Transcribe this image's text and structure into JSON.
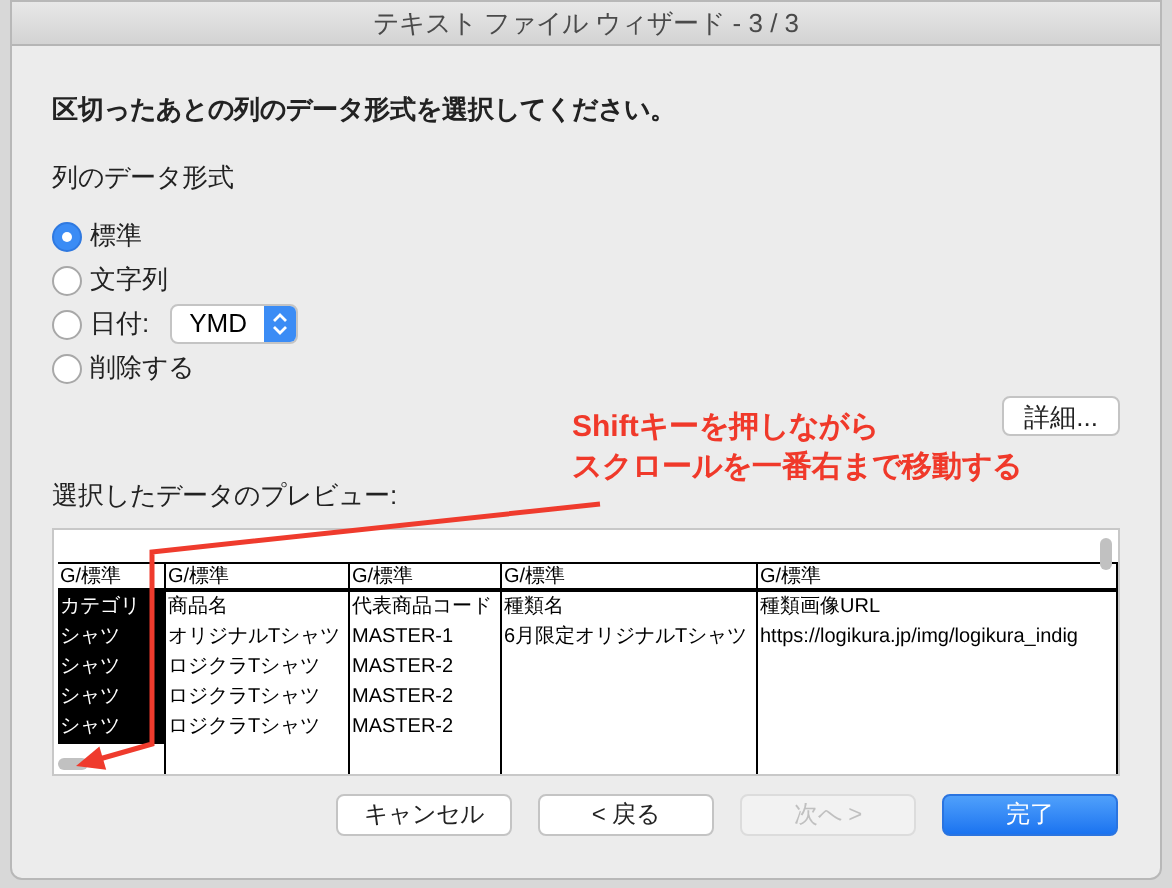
{
  "window": {
    "title": "テキスト ファイル ウィザード - 3 / 3"
  },
  "instruction": "区切ったあとの列のデータ形式を選択してください。",
  "format_group": {
    "label": "列のデータ形式",
    "options": [
      {
        "label": "標準",
        "selected": true,
        "kind": "plain"
      },
      {
        "label": "文字列",
        "selected": false,
        "kind": "plain"
      },
      {
        "label": "日付:",
        "selected": false,
        "kind": "date",
        "dropdown": "YMD"
      },
      {
        "label": "削除する",
        "selected": false,
        "kind": "plain"
      }
    ]
  },
  "details_button": "詳細...",
  "annotation": {
    "lines": [
      "Shiftキーを押しながら",
      "スクロールを一番右まで移動する"
    ]
  },
  "preview": {
    "label": "選択したデータのプレビュー:",
    "columns": [
      {
        "format": "G/標準",
        "selected": true,
        "cells": [
          "カテゴリ",
          "シャツ",
          "シャツ",
          "シャツ",
          "シャツ"
        ]
      },
      {
        "format": "G/標準",
        "selected": false,
        "cells": [
          "商品名",
          "オリジナルTシャツ",
          "ロジクラTシャツ",
          "ロジクラTシャツ",
          "ロジクラTシャツ"
        ]
      },
      {
        "format": "G/標準",
        "selected": false,
        "cells": [
          "代表商品コード",
          "MASTER-1",
          "MASTER-2",
          "MASTER-2",
          "MASTER-2"
        ]
      },
      {
        "format": "G/標準",
        "selected": false,
        "cells": [
          "種類名",
          "6月限定オリジナルTシャツ"
        ]
      },
      {
        "format": "G/標準",
        "selected": false,
        "cells": [
          "種類画像URL",
          "https://logikura.jp/img/logikura_indig"
        ]
      }
    ]
  },
  "buttons": [
    {
      "label": "キャンセル",
      "kind": "default",
      "disabled": false
    },
    {
      "label": "< 戻る",
      "kind": "default",
      "disabled": false
    },
    {
      "label": "次へ >",
      "kind": "default",
      "disabled": true
    },
    {
      "label": "完了",
      "kind": "primary",
      "disabled": false
    }
  ]
}
